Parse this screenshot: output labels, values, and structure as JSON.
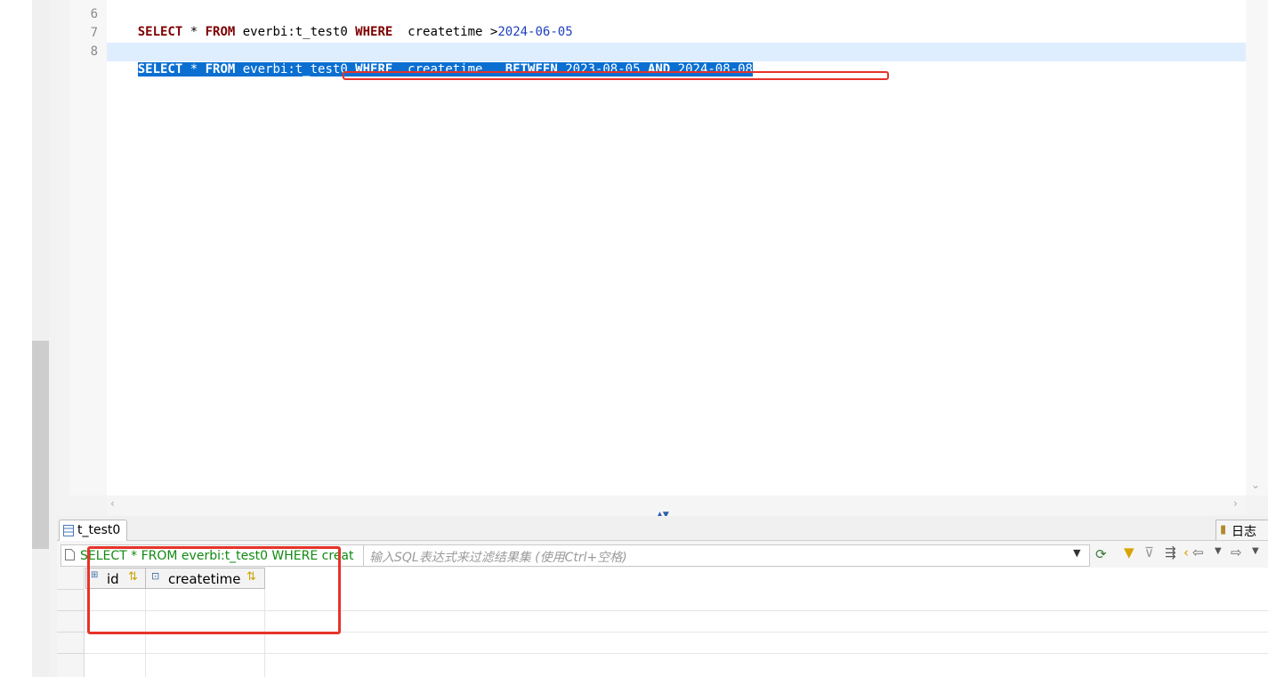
{
  "editor": {
    "line_numbers": [
      "6",
      "7",
      "8"
    ],
    "line6": {
      "select": "SELECT",
      "star": " * ",
      "from": "FROM",
      "table": " everbi:t_test0 ",
      "where": "WHERE",
      "col": "  createtime >",
      "value": "2024-06-05"
    },
    "line8": {
      "select": "SELECT",
      "star": " * ",
      "from": "FROM",
      "table": " everbi:t_test0 ",
      "where": "WHERE",
      "col": "  createtime   ",
      "between": "BETWEEN",
      "v1": " 2023-08-05 ",
      "and": "AND",
      "v2": " 2024-08-08"
    }
  },
  "results": {
    "tab_label": "t_test0",
    "log_tab_label": "日志",
    "sql_preview": "SELECT * FROM everbi:t_test0 WHERE creat",
    "filter_placeholder": "输入SQL表达式来过滤结果集 (使用Ctrl+空格)",
    "columns": [
      "id",
      "createtime"
    ]
  },
  "colors": {
    "keyword": "#7f0000",
    "string": "#1f3fbf",
    "selection": "#0a6fd1",
    "annotation_red": "#e6332a"
  }
}
